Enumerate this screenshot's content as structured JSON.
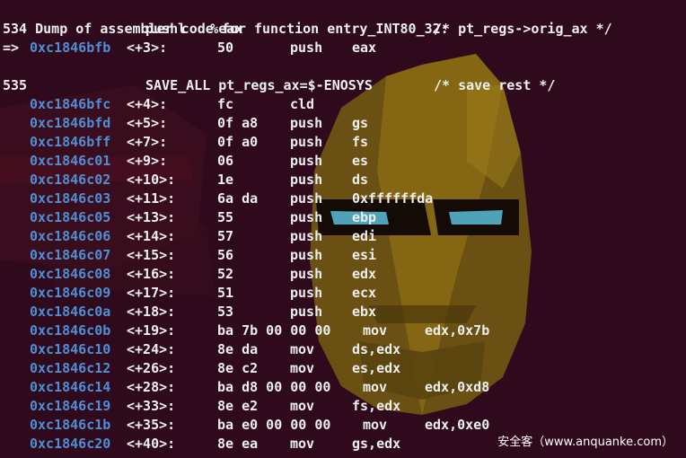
{
  "header": {
    "text": "Dump of assembler code for function entry_INT80_32:"
  },
  "source_lines": [
    {
      "lineno": "534",
      "code": "pushl   %eax",
      "comment": "/* pt_regs->orig_ax */"
    },
    {
      "lineno": "535",
      "code": "SAVE_ALL pt_regs_ax=$-ENOSYS",
      "comment": "/* save rest */"
    }
  ],
  "current_instruction": {
    "marker": "=>",
    "address": "0xc1846bfb",
    "offset": "<+3>:",
    "bytes": "50",
    "mnemonic": "push",
    "operands": "eax"
  },
  "instructions": [
    {
      "address": "0xc1846bfc",
      "offset": "<+4>:",
      "bytes": "fc",
      "mnemonic": "cld",
      "operands": ""
    },
    {
      "address": "0xc1846bfd",
      "offset": "<+5>:",
      "bytes": "0f a8",
      "mnemonic": "push",
      "operands": "gs"
    },
    {
      "address": "0xc1846bff",
      "offset": "<+7>:",
      "bytes": "0f a0",
      "mnemonic": "push",
      "operands": "fs"
    },
    {
      "address": "0xc1846c01",
      "offset": "<+9>:",
      "bytes": "06",
      "mnemonic": "push",
      "operands": "es"
    },
    {
      "address": "0xc1846c02",
      "offset": "<+10>:",
      "bytes": "1e",
      "mnemonic": "push",
      "operands": "ds"
    },
    {
      "address": "0xc1846c03",
      "offset": "<+11>:",
      "bytes": "6a da",
      "mnemonic": "push",
      "operands": "0xffffffda"
    },
    {
      "address": "0xc1846c05",
      "offset": "<+13>:",
      "bytes": "55",
      "mnemonic": "push",
      "operands": "ebp"
    },
    {
      "address": "0xc1846c06",
      "offset": "<+14>:",
      "bytes": "57",
      "mnemonic": "push",
      "operands": "edi"
    },
    {
      "address": "0xc1846c07",
      "offset": "<+15>:",
      "bytes": "56",
      "mnemonic": "push",
      "operands": "esi"
    },
    {
      "address": "0xc1846c08",
      "offset": "<+16>:",
      "bytes": "52",
      "mnemonic": "push",
      "operands": "edx"
    },
    {
      "address": "0xc1846c09",
      "offset": "<+17>:",
      "bytes": "51",
      "mnemonic": "push",
      "operands": "ecx"
    },
    {
      "address": "0xc1846c0a",
      "offset": "<+18>:",
      "bytes": "53",
      "mnemonic": "push",
      "operands": "ebx"
    },
    {
      "address": "0xc1846c0b",
      "offset": "<+19>:",
      "bytes": "ba 7b 00 00 00",
      "mnemonic": "mov",
      "operands": "edx,0x7b"
    },
    {
      "address": "0xc1846c10",
      "offset": "<+24>:",
      "bytes": "8e da",
      "mnemonic": "mov",
      "operands": "ds,edx"
    },
    {
      "address": "0xc1846c12",
      "offset": "<+26>:",
      "bytes": "8e c2",
      "mnemonic": "mov",
      "operands": "es,edx"
    },
    {
      "address": "0xc1846c14",
      "offset": "<+28>:",
      "bytes": "ba d8 00 00 00",
      "mnemonic": "mov",
      "operands": "edx,0xd8"
    },
    {
      "address": "0xc1846c19",
      "offset": "<+33>:",
      "bytes": "8e e2",
      "mnemonic": "mov",
      "operands": "fs,edx"
    },
    {
      "address": "0xc1846c1b",
      "offset": "<+35>:",
      "bytes": "ba e0 00 00 00",
      "mnemonic": "mov",
      "operands": "edx,0xe0"
    },
    {
      "address": "0xc1846c20",
      "offset": "<+40>:",
      "bytes": "8e ea",
      "mnemonic": "mov",
      "operands": "gs,edx"
    }
  ],
  "watermark": "安全客（www.anquanke.com）",
  "colors": {
    "background": "#2f0a1c",
    "text": "#efefef",
    "address": "#4e8fd6",
    "wallpaper_gold": "#8a6a14"
  }
}
